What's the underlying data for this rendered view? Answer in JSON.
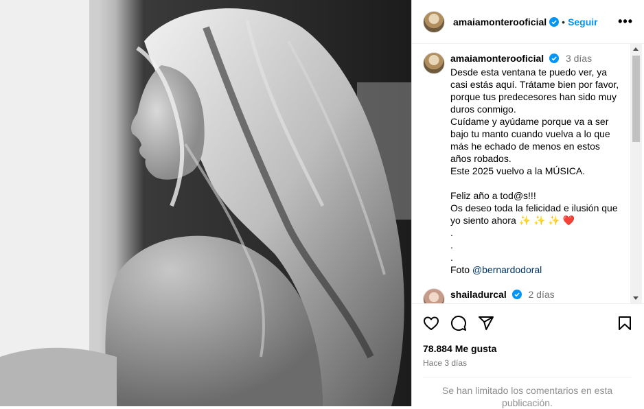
{
  "post": {
    "author": "amaiamonterooficial",
    "follow_label": "Seguir",
    "separator": "•",
    "more_label": "•••"
  },
  "caption": {
    "author": "amaiamonterooficial",
    "time": "3 días",
    "lines": [
      "Desde esta ventana te puedo ver, ya casi estás aquí. Trátame bien por favor, porque tus predecesores han sido muy duros conmigo.",
      "Cuídame y ayúdame porque va a ser bajo tu manto cuando vuelva a lo que más he echado de menos en estos años robados.",
      "Este 2025 vuelvo a la MÚSICA.",
      "",
      "Feliz año a tod@s!!!",
      "Os deseo toda la felicidad e ilusión que yo siento ahora ✨ ✨ ✨ ❤️",
      ".",
      ".",
      "."
    ],
    "photo_credit_prefix": "Foto ",
    "photo_credit_mention": "@bernardodoral"
  },
  "comment2": {
    "author": "shailadurcal",
    "time": "2 días"
  },
  "actions": {
    "icons": [
      "heart-icon",
      "comment-icon",
      "share-icon",
      "bookmark-icon"
    ],
    "likes": "78.884 Me gusta",
    "ago": "Hace 3 días"
  },
  "comments_limited": "Se han limitado los comentarios en esta publicación.",
  "colors": {
    "accent": "#0095f6",
    "verified": "#0095f6",
    "mention": "#00376b",
    "muted": "#737373"
  }
}
